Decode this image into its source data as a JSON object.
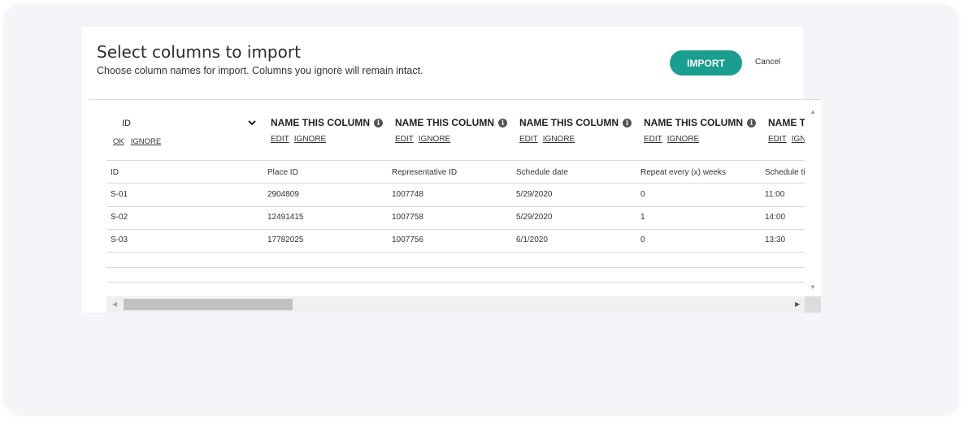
{
  "dialog": {
    "title": "Select columns to import",
    "subtitle": "Choose column names for import. Columns you ignore will remain intact.",
    "import_label": "IMPORT",
    "cancel_label": "Cancel"
  },
  "colors": {
    "accent": "#1a9e8f"
  },
  "columns": [
    {
      "header": "ID",
      "links": [
        "OK",
        "IGNORE"
      ],
      "field": "ID"
    },
    {
      "header": "NAME THIS COLUMN",
      "links": [
        "EDIT",
        "IGNORE"
      ],
      "field": "Place ID"
    },
    {
      "header": "NAME THIS COLUMN",
      "links": [
        "EDIT",
        "IGNORE"
      ],
      "field": "Representative ID"
    },
    {
      "header": "NAME THIS COLUMN",
      "links": [
        "EDIT",
        "IGNORE"
      ],
      "field": "Schedule date"
    },
    {
      "header": "NAME THIS COLUMN",
      "links": [
        "EDIT",
        "IGNORE"
      ],
      "field": "Repeat every (x) weeks"
    },
    {
      "header": "NAME THIS COLUMN",
      "links": [
        "EDIT",
        "IGNORE"
      ],
      "field": "Schedule time"
    }
  ],
  "rows": [
    [
      "S-01",
      "2904809",
      "1007748",
      "5/29/2020",
      "0",
      "11:00"
    ],
    [
      "S-02",
      "12491415",
      "1007758",
      "5/29/2020",
      "1",
      "14:00"
    ],
    [
      "S-03",
      "17782025",
      "1007756",
      "6/1/2020",
      "0",
      "13:30"
    ]
  ],
  "icons": {
    "info": "info-icon",
    "chevron": "chevron-down-icon",
    "scroll_up": "scroll-up-icon",
    "scroll_down": "scroll-down-icon",
    "scroll_left": "scroll-left-icon",
    "scroll_right": "scroll-right-icon"
  }
}
